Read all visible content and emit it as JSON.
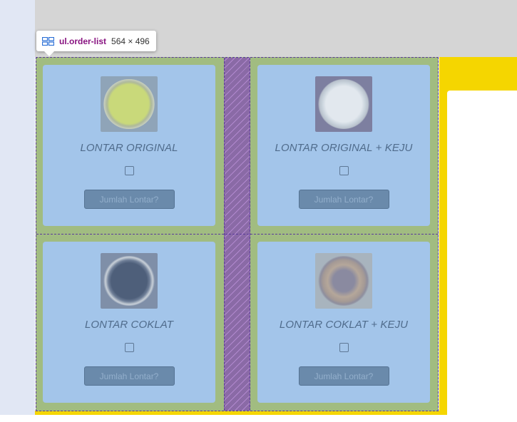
{
  "inspector": {
    "selector": "ul.order-list",
    "size": "564 × 496",
    "icon": "grid-layout-icon"
  },
  "colors": {
    "grid_overlay": "#a1bc81",
    "card_overlay": "#a3c5ea",
    "gap_hatch": "#8a6aa6",
    "page_yellow": "#f5d600"
  },
  "products": [
    {
      "name": "LONTAR ORIGINAL",
      "button": "Jumlah Lontar?",
      "image": "lontar-original-photo"
    },
    {
      "name": "LONTAR ORIGINAL + KEJU",
      "button": "Jumlah Lontar?",
      "image": "lontar-original-keju-photo"
    },
    {
      "name": "LONTAR COKLAT",
      "button": "Jumlah Lontar?",
      "image": "lontar-coklat-photo"
    },
    {
      "name": "LONTAR COKLAT + KEJU",
      "button": "Jumlah Lontar?",
      "image": "lontar-coklat-keju-photo"
    }
  ]
}
